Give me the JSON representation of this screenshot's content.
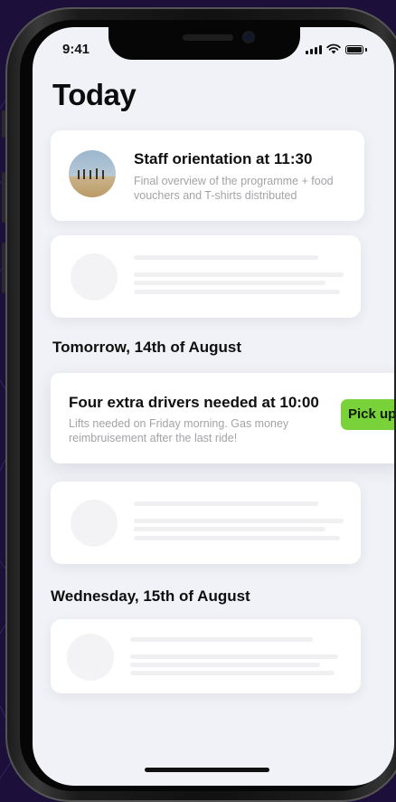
{
  "status_bar": {
    "time": "9:41"
  },
  "page_title": "Today",
  "today_cards": [
    {
      "title": "Staff orientation at 11:30",
      "description": "Final overview of the programme + food vouchers and T-shirts distributed"
    }
  ],
  "sections": [
    {
      "heading": "Tomorrow, 14th of August"
    },
    {
      "heading": "Wednesday, 15th of August"
    }
  ],
  "tomorrow_card": {
    "title": "Four extra drivers needed at 10:00",
    "description": "Lifts needed on Friday morning. Gas money reimbruisement after the last ride!",
    "action_label": "Pick up"
  },
  "icons": [
    "signal-icon",
    "wifi-icon",
    "battery-icon",
    "event-photo"
  ],
  "colors": {
    "accent": "#79d23a",
    "background": "#1c0f3a",
    "screen": "#f1f2f7"
  }
}
